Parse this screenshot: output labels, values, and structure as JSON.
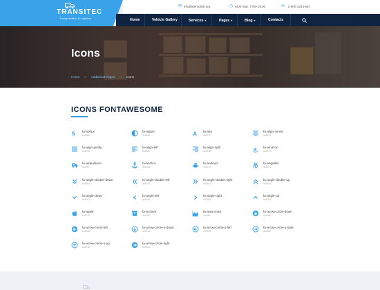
{
  "logo": {
    "title": "TRANSITEC",
    "subtitle": "Transportation & Logistics"
  },
  "topbar": {
    "email": "info@demolink.org",
    "hours": "Mon–Sat: 7:00–19:00",
    "phone": "1-800-1234-567"
  },
  "nav": {
    "items": [
      {
        "label": "Home",
        "dropdown": false
      },
      {
        "label": "Vehicle Gallery",
        "dropdown": false
      },
      {
        "label": "Services",
        "dropdown": true
      },
      {
        "label": "Pages",
        "dropdown": true
      },
      {
        "label": "Blog",
        "dropdown": true
      },
      {
        "label": "Contacts",
        "dropdown": false
      }
    ]
  },
  "hero": {
    "title": "Icons",
    "breadcrumb": [
      "Home",
      "Additional Pages",
      "Icons"
    ]
  },
  "section": {
    "title": "ICONS FONTAWESOME"
  },
  "icons": [
    {
      "name": "fa-500px",
      "code": "#xf26e",
      "icon": "500px-icon"
    },
    {
      "name": "fa-adjust",
      "code": "#xf042",
      "icon": "adjust-icon"
    },
    {
      "name": "fa-adn",
      "code": "#xf170",
      "icon": "adn-icon"
    },
    {
      "name": "fa-align-center",
      "code": "#xf037",
      "icon": "align-center-icon"
    },
    {
      "name": "fa-align-justify",
      "code": "#xf039",
      "icon": "align-justify-icon"
    },
    {
      "name": "fa-align-left",
      "code": "#xf036",
      "icon": "align-left-icon"
    },
    {
      "name": "fa-align-right",
      "code": "#xf038",
      "icon": "align-right-icon"
    },
    {
      "name": "fa-amazon",
      "code": "#xf270",
      "icon": "amazon-icon"
    },
    {
      "name": "fa-ambulance",
      "code": "#xf0f9",
      "icon": "ambulance-icon"
    },
    {
      "name": "fa-anchor",
      "code": "#xf13d",
      "icon": "anchor-icon"
    },
    {
      "name": "fa-android",
      "code": "#xf17b",
      "icon": "android-icon"
    },
    {
      "name": "fa-angellist",
      "code": "#xf209",
      "icon": "angellist-icon"
    },
    {
      "name": "fa-angle-double-down",
      "code": "#xf103",
      "icon": "angle-double-down-icon"
    },
    {
      "name": "fa-angle-double-left",
      "code": "#xf100",
      "icon": "angle-double-left-icon"
    },
    {
      "name": "fa-angle-double-right",
      "code": "#xf101",
      "icon": "angle-double-right-icon"
    },
    {
      "name": "fa-angle-double-up",
      "code": "#xf102",
      "icon": "angle-double-up-icon"
    },
    {
      "name": "fa-angle-down",
      "code": "#xf107",
      "icon": "angle-down-icon"
    },
    {
      "name": "fa-angle-left",
      "code": "#xf104",
      "icon": "angle-left-icon"
    },
    {
      "name": "fa-angle-right",
      "code": "#xf105",
      "icon": "angle-right-icon"
    },
    {
      "name": "fa-angle-up",
      "code": "#xf106",
      "icon": "angle-up-icon"
    },
    {
      "name": "fa-apple",
      "code": "#xf179",
      "icon": "apple-icon"
    },
    {
      "name": "fa-archive",
      "code": "#xf187",
      "icon": "archive-icon"
    },
    {
      "name": "fa-area-chart",
      "code": "#xf1fe",
      "icon": "area-chart-icon"
    },
    {
      "name": "fa-arrow-circle-down",
      "code": "#xf0ab",
      "icon": "arrow-circle-down-icon"
    },
    {
      "name": "fa-arrow-circle-left",
      "code": "#xf0a8",
      "icon": "arrow-circle-left-icon"
    },
    {
      "name": "fa-arrow-circle-o-down",
      "code": "#xf01a",
      "icon": "arrow-circle-o-down-icon"
    },
    {
      "name": "fa-arrow-circle-o-left",
      "code": "#xf190",
      "icon": "arrow-circle-o-left-icon"
    },
    {
      "name": "fa-arrow-circle-o-right",
      "code": "#xf18e",
      "icon": "arrow-circle-o-right-icon"
    },
    {
      "name": "fa-arrow-circle-o-up",
      "code": "#xf01b",
      "icon": "arrow-circle-o-up-icon"
    },
    {
      "name": "fa-arrow-circle-right",
      "code": "#xf0a9",
      "icon": "arrow-circle-right-icon"
    }
  ],
  "colors": {
    "accent": "#38a3e8",
    "navy": "#0f2440",
    "background": "#eef2f6"
  }
}
